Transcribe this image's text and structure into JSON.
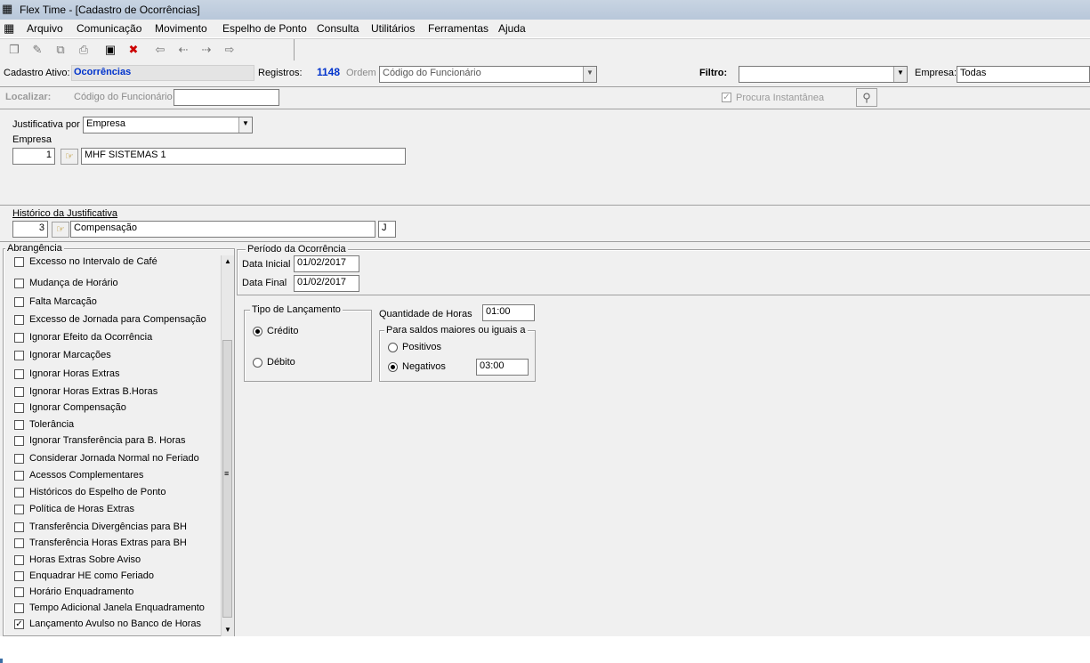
{
  "window": {
    "title": "Flex Time - [Cadastro de Ocorrências]"
  },
  "menu": [
    "Arquivo",
    "Comunicação",
    "Movimento",
    "Espelho de Ponto",
    "Consulta",
    "Utilitários",
    "Ferramentas",
    "Ajuda"
  ],
  "toolbar": {
    "icons": [
      "new-icon",
      "edit-icon",
      "copy-icon",
      "print-icon",
      "save-icon",
      "delete-icon",
      "first-icon",
      "prev-icon",
      "next-icon",
      "last-icon"
    ]
  },
  "status": {
    "cadastro_label": "Cadastro Ativo:",
    "cadastro_value": "Ocorrências",
    "registros_label": "Registros:",
    "registros_value": "1148",
    "ordem_label": "Ordem",
    "ordem_value": "Código do Funcionário",
    "filtro_label": "Filtro:",
    "filtro_value": "",
    "empresa_label": "Empresa:",
    "empresa_value": "Todas"
  },
  "search": {
    "localizar_label": "Localizar:",
    "campo_label": "Código do Funcionário",
    "campo_value": "",
    "procura_label": "Procura Instantânea"
  },
  "form": {
    "justificativa_label": "Justificativa por",
    "justificativa_value": "Empresa",
    "empresa_label": "Empresa",
    "empresa_code": "1",
    "empresa_name": "MHF SISTEMAS 1",
    "historico_label": "Histórico da Justificativa",
    "historico_code": "3",
    "historico_name": "Compensação",
    "historico_tipo": "J"
  },
  "abrangencia": {
    "title": "Abrangência",
    "items": [
      {
        "label": "Excesso no Intervalo de Café",
        "checked": false
      },
      {
        "label": "Mudança de Horário",
        "checked": false
      },
      {
        "label": "Falta Marcação",
        "checked": false
      },
      {
        "label": "Excesso de Jornada para Compensação",
        "checked": false
      },
      {
        "label": "Ignorar Efeito da Ocorrência",
        "checked": false
      },
      {
        "label": "Ignorar Marcações",
        "checked": false
      },
      {
        "label": "Ignorar Horas Extras",
        "checked": false
      },
      {
        "label": "Ignorar Horas Extras B.Horas",
        "checked": false
      },
      {
        "label": "Ignorar Compensação",
        "checked": false
      },
      {
        "label": "Tolerância",
        "checked": false
      },
      {
        "label": "Ignorar Transferência para B. Horas",
        "checked": false
      },
      {
        "label": "Considerar Jornada Normal no Feriado",
        "checked": false
      },
      {
        "label": "Acessos Complementares",
        "checked": false
      },
      {
        "label": "Históricos do Espelho de Ponto",
        "checked": false
      },
      {
        "label": "Política de Horas Extras",
        "checked": false
      },
      {
        "label": "Transferência Divergências para BH",
        "checked": false
      },
      {
        "label": "Transferência Horas Extras para BH",
        "checked": false
      },
      {
        "label": "Horas Extras Sobre Aviso",
        "checked": false
      },
      {
        "label": "Enquadrar HE como Feriado",
        "checked": false
      },
      {
        "label": "Horário Enquadramento",
        "checked": false
      },
      {
        "label": "Tempo Adicional Janela Enquadramento",
        "checked": false
      },
      {
        "label": "Lançamento Avulso no Banco de Horas",
        "checked": true
      }
    ]
  },
  "periodo": {
    "title": "Período  da Ocorrência",
    "inicial_label": "Data Inicial",
    "inicial_value": "01/02/2017",
    "final_label": "Data Final",
    "final_value": "01/02/2017"
  },
  "lancamento": {
    "title": "Tipo de Lançamento",
    "credito_label": "Crédito",
    "debito_label": "Débito",
    "selected": "credito"
  },
  "quantidade": {
    "label": "Quantidade de Horas",
    "value": "01:00"
  },
  "saldos": {
    "title": "Para saldos maiores ou iguais a",
    "positivos_label": "Positivos",
    "negativos_label": "Negativos",
    "negativos_value": "03:00",
    "selected": "negativos"
  },
  "colors": {
    "gray_bg": "#f0f0f0",
    "highlight_blue": "#0033cc"
  }
}
